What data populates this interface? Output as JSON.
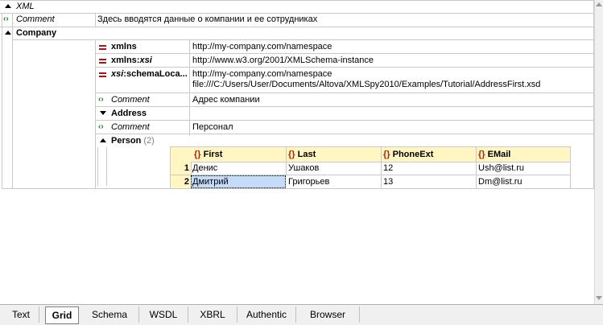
{
  "root": {
    "label": "XML"
  },
  "doc_comment": {
    "label": "Comment",
    "value": "Здесь вводятся данные о компании и ее сотрудниках"
  },
  "company": {
    "label": "Company",
    "attrs": [
      {
        "name": "xmlns",
        "suffix": "",
        "value": "http://my-company.com/namespace",
        "value2": ""
      },
      {
        "name": "xmlns:",
        "suffix": "xsi",
        "value": "http://www.w3.org/2001/XMLSchema-instance",
        "value2": ""
      },
      {
        "name": "xsi",
        "suffix": ":schemaLoca...",
        "value": "http://my-company.com/namespace",
        "value2": "file:///C:/Users/User/Documents/Altova/XMLSpy2010/Examples/Tutorial/AddressFirst.xsd"
      }
    ],
    "comment": {
      "label": "Comment",
      "value": "Адрес компании"
    },
    "address": {
      "label": "Address"
    },
    "comment2": {
      "label": "Comment",
      "value": "Персонал"
    },
    "person": {
      "label": "Person",
      "count": "(2)",
      "columns": [
        "First",
        "Last",
        "PhoneExt",
        "EMail"
      ],
      "rows": [
        {
          "num": "1",
          "cells": [
            "Денис",
            "Ушаков",
            "12",
            "Ush@list.ru"
          ]
        },
        {
          "num": "2",
          "cells": [
            "Дмитрий",
            "Григорьев",
            "13",
            "Dm@list.ru"
          ]
        }
      ]
    }
  },
  "tabs": [
    "Text",
    "Grid",
    "Schema",
    "WSDL",
    "XBRL",
    "Authentic",
    "Browser"
  ],
  "active_tab": "Grid",
  "colors": {
    "header_bg": "#fff6c2",
    "selected_cell": "#c5dcf8",
    "attr_icon": "#b01010",
    "comment_icon": "#1b7a1b"
  },
  "icons": {
    "attribute": "equals-icon",
    "comment": "comment-icon",
    "element": "braces-icon"
  }
}
